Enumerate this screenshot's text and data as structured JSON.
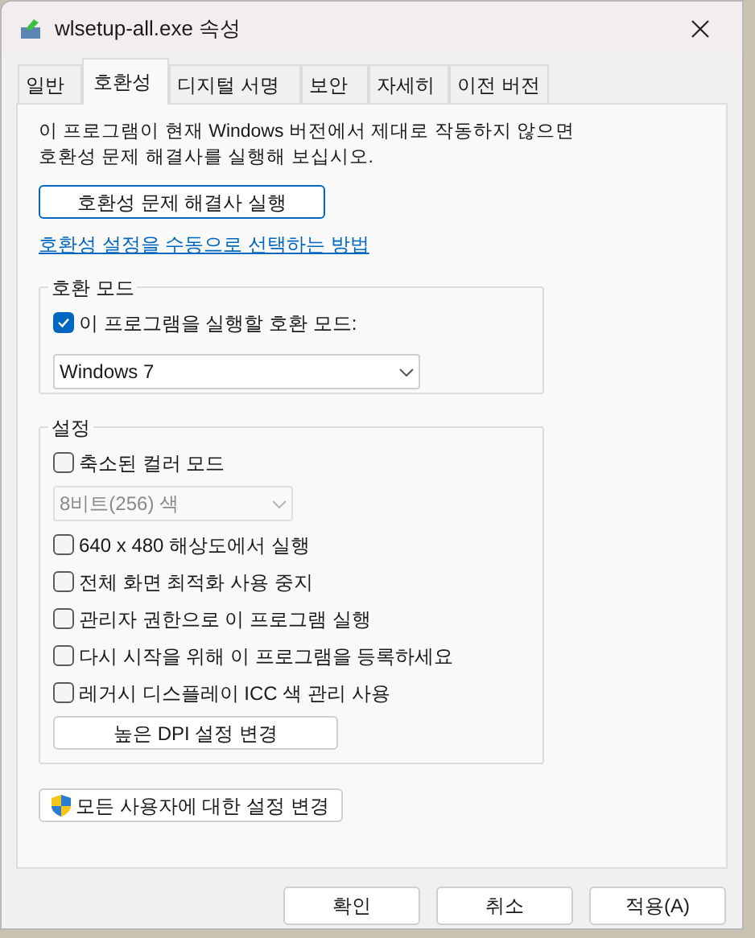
{
  "window": {
    "title": "wlsetup-all.exe 속성"
  },
  "tabs": [
    {
      "label": "일반",
      "selected": false
    },
    {
      "label": "호환성",
      "selected": true
    },
    {
      "label": "디지털 서명",
      "selected": false
    },
    {
      "label": "보안",
      "selected": false
    },
    {
      "label": "자세히",
      "selected": false
    },
    {
      "label": "이전 버전",
      "selected": false
    }
  ],
  "intro": "이 프로그램이 현재 Windows 버전에서 제대로 작동하지 않으면 호환성 문제 해결사를 실행해 보십시오.",
  "troubleshooter_button": "호환성 문제 해결사 실행",
  "manual_link": "호환성 설정을 수동으로 선택하는 방법",
  "compat_mode": {
    "title": "호환 모드",
    "checkbox": {
      "label": "이 프로그램을 실행할 호환 모드:",
      "checked": true
    },
    "dropdown": {
      "value": "Windows 7",
      "disabled": false
    }
  },
  "settings": {
    "title": "설정",
    "items": [
      {
        "kind": "checkbox",
        "label": "축소된 컬러 모드",
        "checked": false
      },
      {
        "kind": "dropdown",
        "value": "8비트(256) 색",
        "disabled": true
      },
      {
        "kind": "checkbox",
        "label": "640 x 480 해상도에서 실행",
        "checked": false
      },
      {
        "kind": "checkbox",
        "label": "전체 화면 최적화 사용 중지",
        "checked": false
      },
      {
        "kind": "checkbox",
        "label": "관리자 권한으로 이 프로그램 실행",
        "checked": false
      },
      {
        "kind": "checkbox",
        "label": "다시 시작을 위해 이 프로그램을 등록하세요",
        "checked": false
      },
      {
        "kind": "checkbox",
        "label": "레거시 디스플레이 ICC 색 관리 사용",
        "checked": false
      },
      {
        "kind": "button",
        "label": "높은 DPI 설정 변경"
      }
    ]
  },
  "all_users_button": "모든 사용자에 대한 설정 변경",
  "buttons": [
    "확인",
    "취소",
    "적용(A)"
  ]
}
